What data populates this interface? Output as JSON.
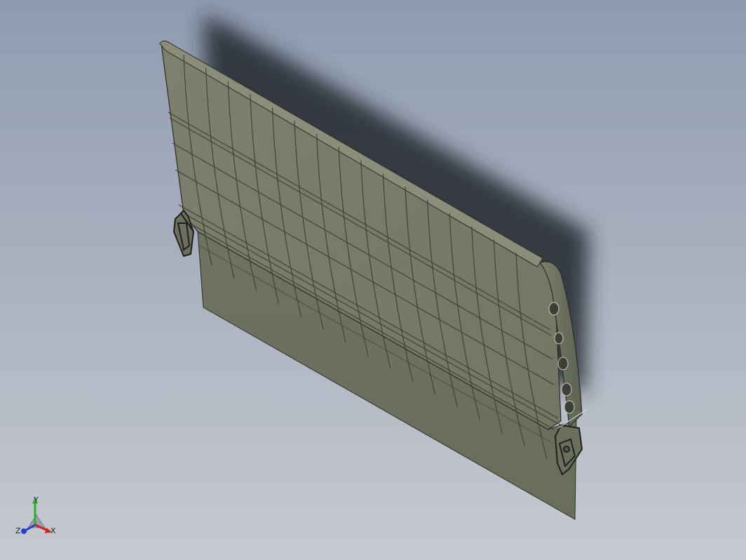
{
  "viewport": {
    "background_top": "#8d9bb0",
    "background_bottom": "#c4c8cf",
    "shadow_color": "#2a2f38"
  },
  "model": {
    "name": "flap-panel",
    "skin_color": "#767966",
    "skin_dark": "#6a6d5a",
    "skin_light": "#8a8c78",
    "rib_line_color": "#3c3e33",
    "edge_color": "#2b2c25",
    "hole_count": 5
  },
  "triad": {
    "x_label": "X",
    "y_label": "Y",
    "z_label": "Z",
    "x_color": "#d81e1e",
    "y_color": "#27b327",
    "z_color": "#2040d8"
  }
}
